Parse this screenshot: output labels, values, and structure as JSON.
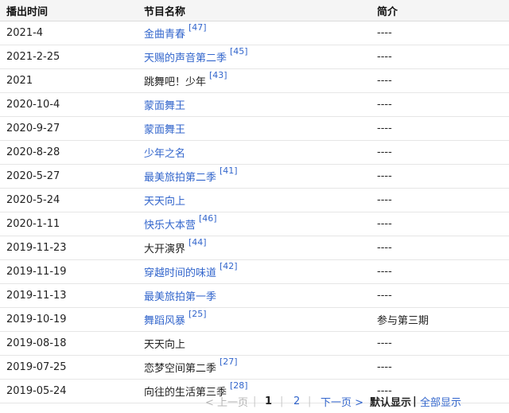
{
  "header": {
    "col_date": "播出时间",
    "col_program": "节目名称",
    "col_desc": "简介"
  },
  "rows": [
    {
      "date": "2021-4",
      "program": "金曲青春",
      "ref": "[47]",
      "linked": true,
      "desc": "----"
    },
    {
      "date": "2021-2-25",
      "program": "天赐的声音第二季",
      "ref": "[45]",
      "linked": true,
      "desc": "----"
    },
    {
      "date": "2021",
      "program": "跳舞吧！少年",
      "ref": "[43]",
      "linked": false,
      "desc": "----"
    },
    {
      "date": "2020-10-4",
      "program": "蒙面舞王",
      "ref": "",
      "linked": true,
      "desc": "----"
    },
    {
      "date": "2020-9-27",
      "program": "蒙面舞王",
      "ref": "",
      "linked": true,
      "desc": "----"
    },
    {
      "date": "2020-8-28",
      "program": "少年之名",
      "ref": "",
      "linked": true,
      "desc": "----"
    },
    {
      "date": "2020-5-27",
      "program": "最美旅拍第二季",
      "ref": "[41]",
      "linked": true,
      "desc": "----"
    },
    {
      "date": "2020-5-24",
      "program": "天天向上",
      "ref": "",
      "linked": true,
      "desc": "----"
    },
    {
      "date": "2020-1-11",
      "program": "快乐大本营",
      "ref": "[46]",
      "linked": true,
      "desc": "----"
    },
    {
      "date": "2019-11-23",
      "program": "大开演界",
      "ref": "[44]",
      "linked": false,
      "desc": "----"
    },
    {
      "date": "2019-11-19",
      "program": "穿越时间的味道",
      "ref": "[42]",
      "linked": true,
      "desc": "----"
    },
    {
      "date": "2019-11-13",
      "program": "最美旅拍第一季",
      "ref": "",
      "linked": true,
      "desc": "----"
    },
    {
      "date": "2019-10-19",
      "program": "舞蹈风暴",
      "ref": "[25]",
      "linked": true,
      "desc": "参与第三期"
    },
    {
      "date": "2019-08-18",
      "program": "天天向上",
      "ref": "",
      "linked": false,
      "desc": "----"
    },
    {
      "date": "2019-07-25",
      "program": "恋梦空间第二季",
      "ref": "[27]",
      "linked": false,
      "desc": "----"
    },
    {
      "date": "2019-05-24",
      "program": "向往的生活第三季",
      "ref": "[28]",
      "linked": false,
      "desc": "----"
    }
  ],
  "pager": {
    "prev": "< 上一页",
    "sep": "|",
    "page1": "1",
    "page2": "2",
    "next": "下一页 >",
    "default_view": "默认显示",
    "bar": "|",
    "all_view": "全部显示"
  }
}
